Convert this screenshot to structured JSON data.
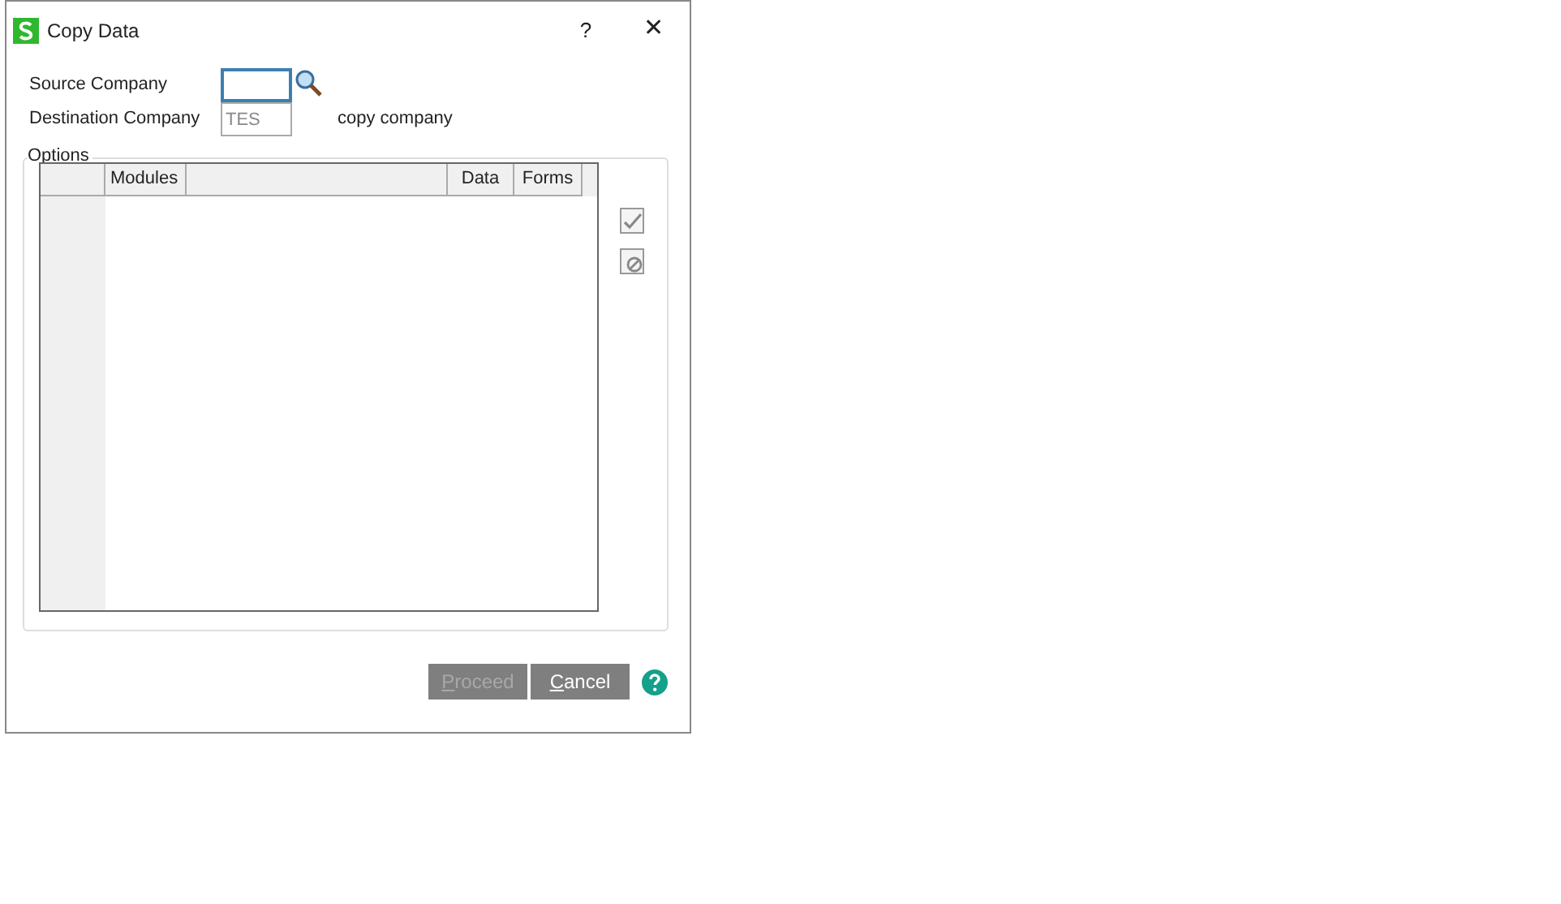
{
  "window": {
    "title": "Copy Data",
    "help_glyph": "?",
    "close_glyph": "✕"
  },
  "fields": [
    {
      "label": "Source Company",
      "focused": true,
      "disabled": false
    },
    {
      "label": "Destination Company",
      "value": "TES",
      "focused": false,
      "disabled": true,
      "note": "copy company"
    }
  ],
  "options": {
    "title": "Options",
    "table": {
      "columns": [
        null,
        "Modules",
        null,
        "Data",
        "Forms"
      ]
    }
  },
  "buttons": [
    {
      "label": "Proceed",
      "disabled": true
    },
    {
      "label": "Cancel",
      "disabled": false
    }
  ]
}
